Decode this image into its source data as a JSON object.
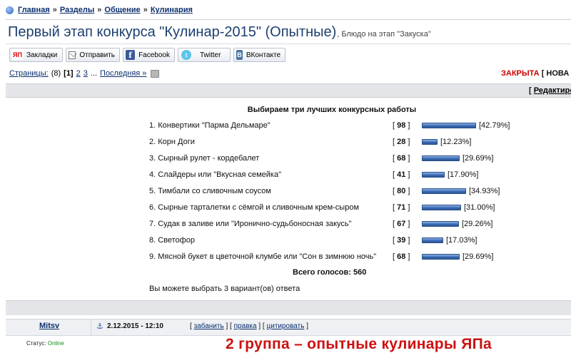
{
  "breadcrumb": {
    "items": [
      "Главная",
      "Разделы",
      "Общение",
      "Кулинария"
    ],
    "separator": "»"
  },
  "title": {
    "main": "Первый этап конкурса \"Кулинар-2015\" (Опытные)",
    "sub": ", Блюдо на этап \"Закуска\""
  },
  "share": [
    {
      "icon": "ЯП",
      "label": "Закладки"
    },
    {
      "icon": "",
      "label": "Отправить"
    },
    {
      "icon": "f",
      "label": "Facebook"
    },
    {
      "icon": "t",
      "label": "Twitter"
    },
    {
      "icon": "В",
      "label": "ВКонтакте"
    }
  ],
  "pagination": {
    "label": "Страницы:",
    "count": "(8)",
    "current": "[1]",
    "pages": [
      "2",
      "3"
    ],
    "ellipsis": "...",
    "last": "Последняя »"
  },
  "topic_status": {
    "closed": "ЗАКРЫТА",
    "bracket": "[",
    "new": "НОВА"
  },
  "edit_link": {
    "open": "[",
    "label": "Редактиро"
  },
  "poll": {
    "heading": "Выбираем три лучших конкурсных работы",
    "options": [
      {
        "label": "1. Конвертики \"Парма Дельмаре\"",
        "votes": "98",
        "percent": "[42.79%]",
        "share": 42.79
      },
      {
        "label": "2. Корн Доги",
        "votes": "28",
        "percent": "[12.23%]",
        "share": 12.23
      },
      {
        "label": "3. Сырный рулет - кордебалет",
        "votes": "68",
        "percent": "[29.69%]",
        "share": 29.69
      },
      {
        "label": "4. Слайдеры или \"Вкусная семейка\"",
        "votes": "41",
        "percent": "[17.90%]",
        "share": 17.9
      },
      {
        "label": "5. Тимбали со сливочным соусом",
        "votes": "80",
        "percent": "[34.93%]",
        "share": 34.93
      },
      {
        "label": "6. Сырные тарталетки с сёмгой и сливочным крем-сыром",
        "votes": "71",
        "percent": "[31.00%]",
        "share": 31.0
      },
      {
        "label": "7. Судак в заливе или \"Иронично-судьбоносная закусь\"",
        "votes": "67",
        "percent": "[29.26%]",
        "share": 29.26
      },
      {
        "label": "8. Светофор",
        "votes": "39",
        "percent": "[17.03%]",
        "share": 17.03
      },
      {
        "label": "9. Мясной букет в цветочной клумбе или \"Сон в зимнюю ночь\"",
        "votes": "68",
        "percent": "[29.69%]",
        "share": 29.69
      }
    ],
    "total": "Всего голосов: 560",
    "note": "Вы можете выбрать 3 вариант(ов) ответа"
  },
  "post": {
    "author": "Mitsv",
    "date": "2.12.2015 - 12:10",
    "actions": [
      "забанить",
      "правка",
      "цитировать"
    ],
    "status_label": "Статус:",
    "status_value": "Online"
  },
  "overlay_caption": "2 группа – опытные кулинары ЯПа"
}
